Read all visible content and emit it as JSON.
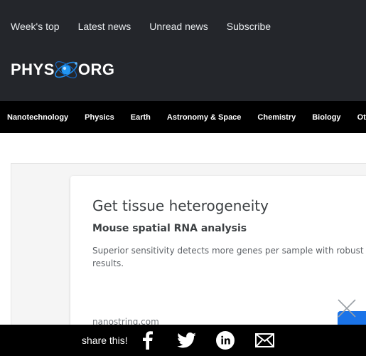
{
  "top_nav": {
    "items": [
      {
        "label": "Week's top"
      },
      {
        "label": "Latest news"
      },
      {
        "label": "Unread news"
      },
      {
        "label": "Subscribe"
      }
    ]
  },
  "logo": {
    "left_text": "PHYS",
    "right_text": "ORG"
  },
  "categories": [
    {
      "label": "Nanotechnology"
    },
    {
      "label": "Physics"
    },
    {
      "label": "Earth"
    },
    {
      "label": "Astronomy & Space"
    },
    {
      "label": "Chemistry"
    },
    {
      "label": "Biology"
    },
    {
      "label": "Other Sciences"
    }
  ],
  "ad": {
    "title": "Get tissue heterogeneity",
    "subtitle": "Mouse spatial RNA analysis",
    "body": "Superior sensitivity detects more genes per sample with robust results.",
    "domain": "nanostring.com"
  },
  "share": {
    "label": "share this!",
    "icons": [
      "facebook-icon",
      "twitter-icon",
      "linkedin-icon",
      "email-icon"
    ]
  },
  "colors": {
    "header_bg": "#24262b",
    "nav_bg": "#000000",
    "accent_blue": "#1a73e8"
  }
}
